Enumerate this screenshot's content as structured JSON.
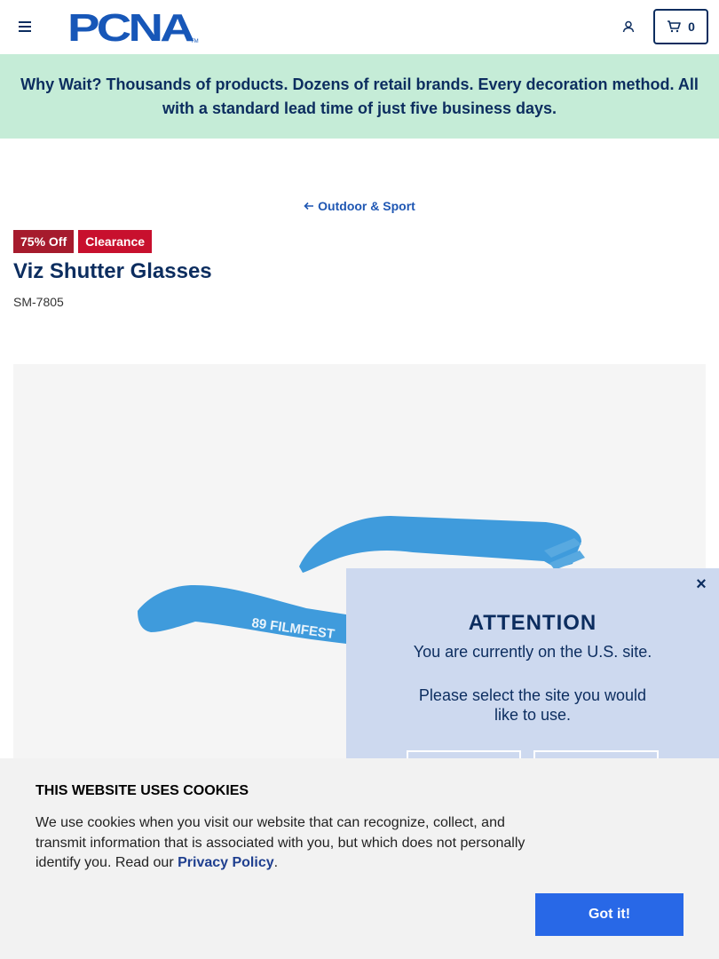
{
  "header": {
    "logo_text": "PCNA",
    "cart_count": "0"
  },
  "promo": {
    "text": "Why Wait? Thousands of products. Dozens of retail brands. Every decoration method. All with a standard lead time of just five business days."
  },
  "breadcrumb": {
    "back_label": "Outdoor & Sport"
  },
  "product": {
    "badges": [
      "75% Off",
      "Clearance"
    ],
    "title": "Viz Shutter Glasses",
    "sku": "SM-7805",
    "imprint_text": "89 FILMFEST",
    "color": "#3f9bdc"
  },
  "site_modal": {
    "close": "×",
    "title": "ATTENTION",
    "line1": "You are currently on the U.S. site.",
    "line2": "Please select the site you would like to use."
  },
  "cookie_banner": {
    "title": "THIS WEBSITE USES COOKIES",
    "text_before": "We use cookies when you visit our website that can recognize, collect, and transmit information that is associated with you, but which does not personally identify you. Read our ",
    "link_label": "Privacy Policy",
    "text_after": ".",
    "button_label": "Got it!"
  },
  "colors": {
    "navy": "#0c2d5f",
    "promo_bg": "#c5ecd7",
    "badge_red": "#c8102e",
    "badge_dark_red": "#a61b2d",
    "accept_blue": "#2868e7",
    "modal_bg": "#cdd9ef"
  }
}
